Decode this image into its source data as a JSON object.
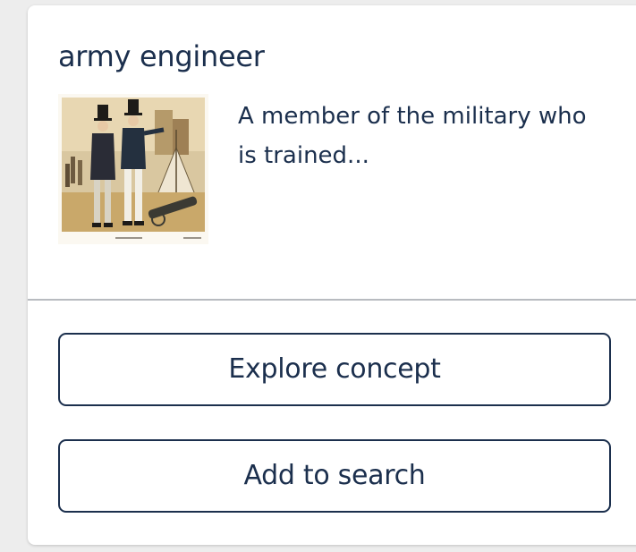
{
  "concept": {
    "title": "army engineer",
    "description": "A member of the military who is trained..."
  },
  "actions": {
    "explore_label": "Explore concept",
    "add_label": "Add to search"
  }
}
